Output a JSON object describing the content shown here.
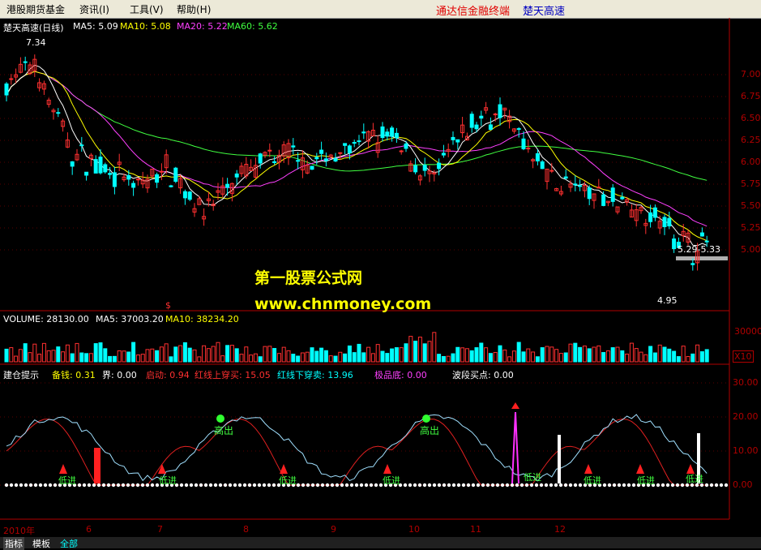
{
  "menu": {
    "items": [
      "港股期货基金",
      "资讯(I)",
      "工具(V)",
      "帮助(H)"
    ],
    "title_brand": "通达信金融终端",
    "title_stock": "楚天高速"
  },
  "colors": {
    "up": "#ff3030",
    "down": "#00ffff",
    "ma5": "#ffffff",
    "ma10": "#ffff00",
    "ma20": "#ff40ff",
    "ma60": "#40ff40",
    "axis_red": "#b00000"
  },
  "main_panel": {
    "stock_label": "楚天高速(日线)",
    "ma5": "MA5: 5.09",
    "ma10": "MA10: 5.08",
    "ma20": "MA20: 5.22",
    "ma60": "MA60: 5.62",
    "high_label": "7.34",
    "low_label": "4.95",
    "range_label": "5.29-5.33",
    "price_ticks": [
      "7.00",
      "6.75",
      "6.50",
      "6.25",
      "6.00",
      "5.75",
      "5.50",
      "5.25",
      "5.00"
    ],
    "dollar_marker": "$"
  },
  "volume_panel": {
    "volume": "VOLUME: 28130.00",
    "ma5": "MA5: 37003.20",
    "ma10": "MA10: 38234.20",
    "tick": "30000",
    "unit": "X10"
  },
  "indicator_panel": {
    "name": "建仓提示",
    "beiqian": "备钱: 0.31",
    "jie": "界: 0.00",
    "qidong": "启动: 0.94",
    "hong_up": "红线上穿买: 15.05",
    "hong_down": "红线下穿卖: 13.96",
    "jipindi": "极品底: 0.00",
    "boduan": "波段买点: 0.00",
    "ticks": [
      "30.00",
      "20.00",
      "10.00",
      "0.00"
    ],
    "sell_label": "高出",
    "buy_label": "低进"
  },
  "x_axis": {
    "labels": [
      "2010年",
      "6",
      "7",
      "8",
      "9",
      "10",
      "11",
      "12"
    ]
  },
  "watermark": {
    "line1": "第一股票公式网",
    "line2": "www.chnmoney.com"
  },
  "tabs": [
    "指标",
    "模板",
    "全部"
  ]
}
